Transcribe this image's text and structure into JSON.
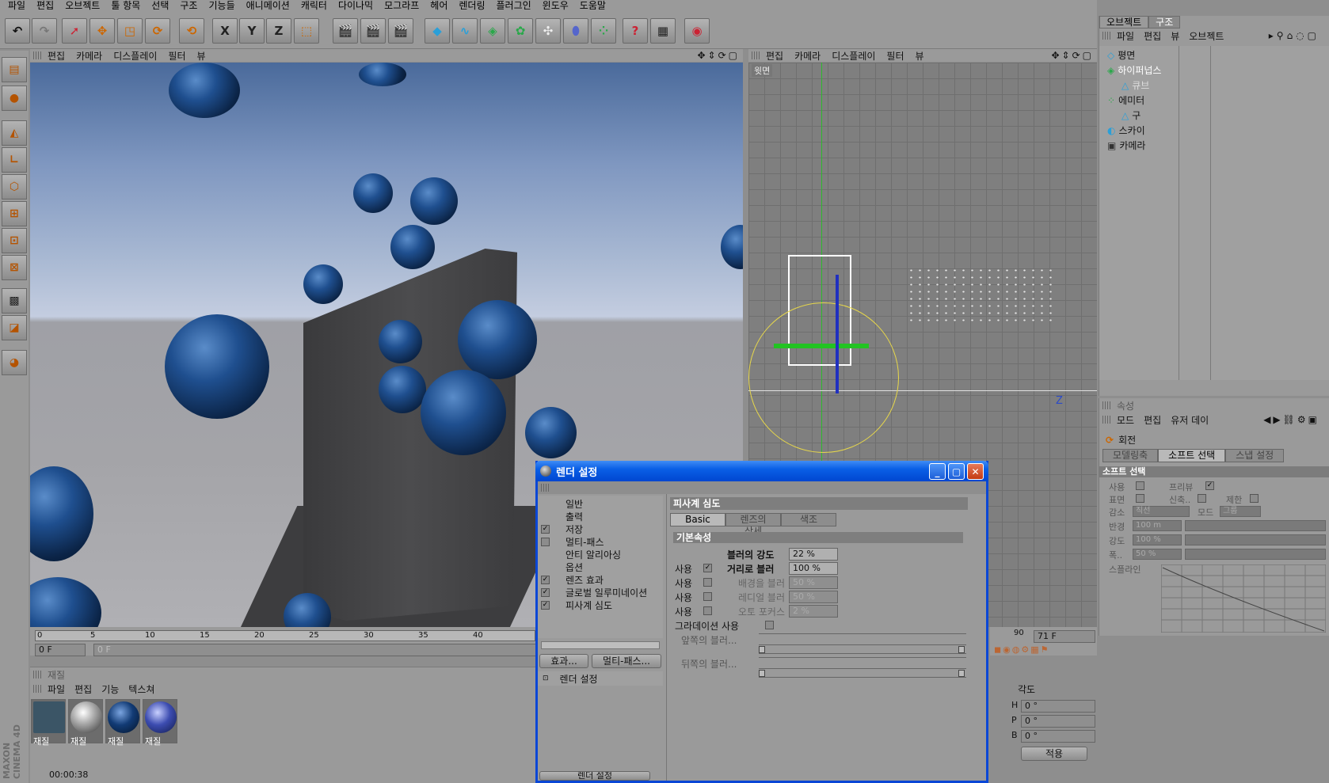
{
  "menu": [
    "파일",
    "편집",
    "오브젝트",
    "툴 항목",
    "선택",
    "구조",
    "기능들",
    "애니메이션",
    "캐릭터",
    "다이나믹",
    "모그라프",
    "헤어",
    "렌더링",
    "플러그인",
    "윈도우",
    "도움말"
  ],
  "toolbar": {
    "x": "X",
    "y": "Y",
    "z": "Z"
  },
  "viewport1": {
    "menu": [
      "편집",
      "카메라",
      "디스플레이",
      "필터",
      "뷰"
    ]
  },
  "viewport2": {
    "menu": [
      "편집",
      "카메라",
      "디스플레이",
      "필터",
      "뷰"
    ],
    "label": "윗면",
    "axis": "Z"
  },
  "timeline": {
    "ticks": [
      "0",
      "5",
      "10",
      "15",
      "20",
      "25",
      "30",
      "35",
      "40"
    ],
    "start_frame": "0 F",
    "current": "0 F",
    "end_tick": "90",
    "end_frame": "71 F"
  },
  "objects_panel": {
    "tabs": [
      "오브젝트",
      "구조"
    ],
    "menu": [
      "파일",
      "편집",
      "뷰",
      "오브젝트"
    ],
    "objects": [
      {
        "name": "평면",
        "indent": 0
      },
      {
        "name": "하이퍼넙스",
        "indent": 0
      },
      {
        "name": "큐브",
        "indent": 1
      },
      {
        "name": "에미터",
        "indent": 0
      },
      {
        "name": "구",
        "indent": 1
      },
      {
        "name": "스카이",
        "indent": 0
      },
      {
        "name": "카메라",
        "indent": 0
      }
    ]
  },
  "attributes_panel": {
    "header": "속성",
    "menu": [
      "모드",
      "편집",
      "유저 데이"
    ],
    "tool": "회전",
    "tabs": [
      "모델링축",
      "소프트 선택",
      "스냅 설정"
    ],
    "section": "소프트 선택",
    "use": "사용",
    "preview": "프리뷰",
    "surface": "표면",
    "stretch": "신축..",
    "limit": "제한",
    "falloff": "감소",
    "falloff_value": "직선",
    "mode": "모드",
    "mode_value": "그룹",
    "radius": "반경",
    "radius_value": "100 m",
    "strength": "강도",
    "strength_value": "100 %",
    "width": "폭..",
    "width_value": "50 %",
    "spline": "스플라인"
  },
  "materials": {
    "header": "재질",
    "menu": [
      "파일",
      "편집",
      "기능",
      "텍스쳐"
    ],
    "items": [
      {
        "label": "재질",
        "color": "#3b5566"
      },
      {
        "label": "재질",
        "color": "#bdbdbd"
      },
      {
        "label": "재질",
        "color": "#123b75"
      },
      {
        "label": "재질",
        "color": "#3c4cb0"
      }
    ]
  },
  "coords": {
    "header": "각도",
    "h": "H",
    "p": "P",
    "b": "B",
    "h_val": "0 °",
    "p_val": "0 °",
    "b_val": "0 °",
    "apply": "적용"
  },
  "status": {
    "time": "00:00:38"
  },
  "dialog": {
    "title": "렌더 설정",
    "nav": [
      {
        "label": "일반",
        "check": "none"
      },
      {
        "label": "출력",
        "check": "none"
      },
      {
        "label": "저장",
        "check": "on"
      },
      {
        "label": "멀티-패스",
        "check": "off"
      },
      {
        "label": "안티 알리아싱",
        "check": "none"
      },
      {
        "label": "옵션",
        "check": "none"
      },
      {
        "label": "렌즈 효과",
        "check": "on"
      },
      {
        "label": "글로벌 일루미네이션",
        "check": "on"
      },
      {
        "label": "피사계 심도",
        "check": "on"
      }
    ],
    "btn_effects": "효과...",
    "btn_multipass": "멀티-패스...",
    "preset": "렌더 설정",
    "btn_bottom": "렌더 설정",
    "section_title": "피사계 심도",
    "tabs": [
      "Basic",
      "렌즈의 상세",
      "색조"
    ],
    "subsection": "기본속성",
    "blur_strength_label": "블러의 강도",
    "blur_strength": "22 %",
    "use": "사용",
    "distance_blur_label": "거리로 블러",
    "distance_blur": "100 %",
    "bg_blur_label": "배경을 블러",
    "bg_blur": "50 %",
    "radial_blur_label": "레디얼 블러",
    "radial_blur": "50 %",
    "auto_focus_label": "오토 포커스",
    "auto_focus": "2 %",
    "gradation": "그라데이션 사용",
    "front_blur": "앞쪽의 블러...",
    "back_blur": "뒤쪽의 블러..."
  }
}
